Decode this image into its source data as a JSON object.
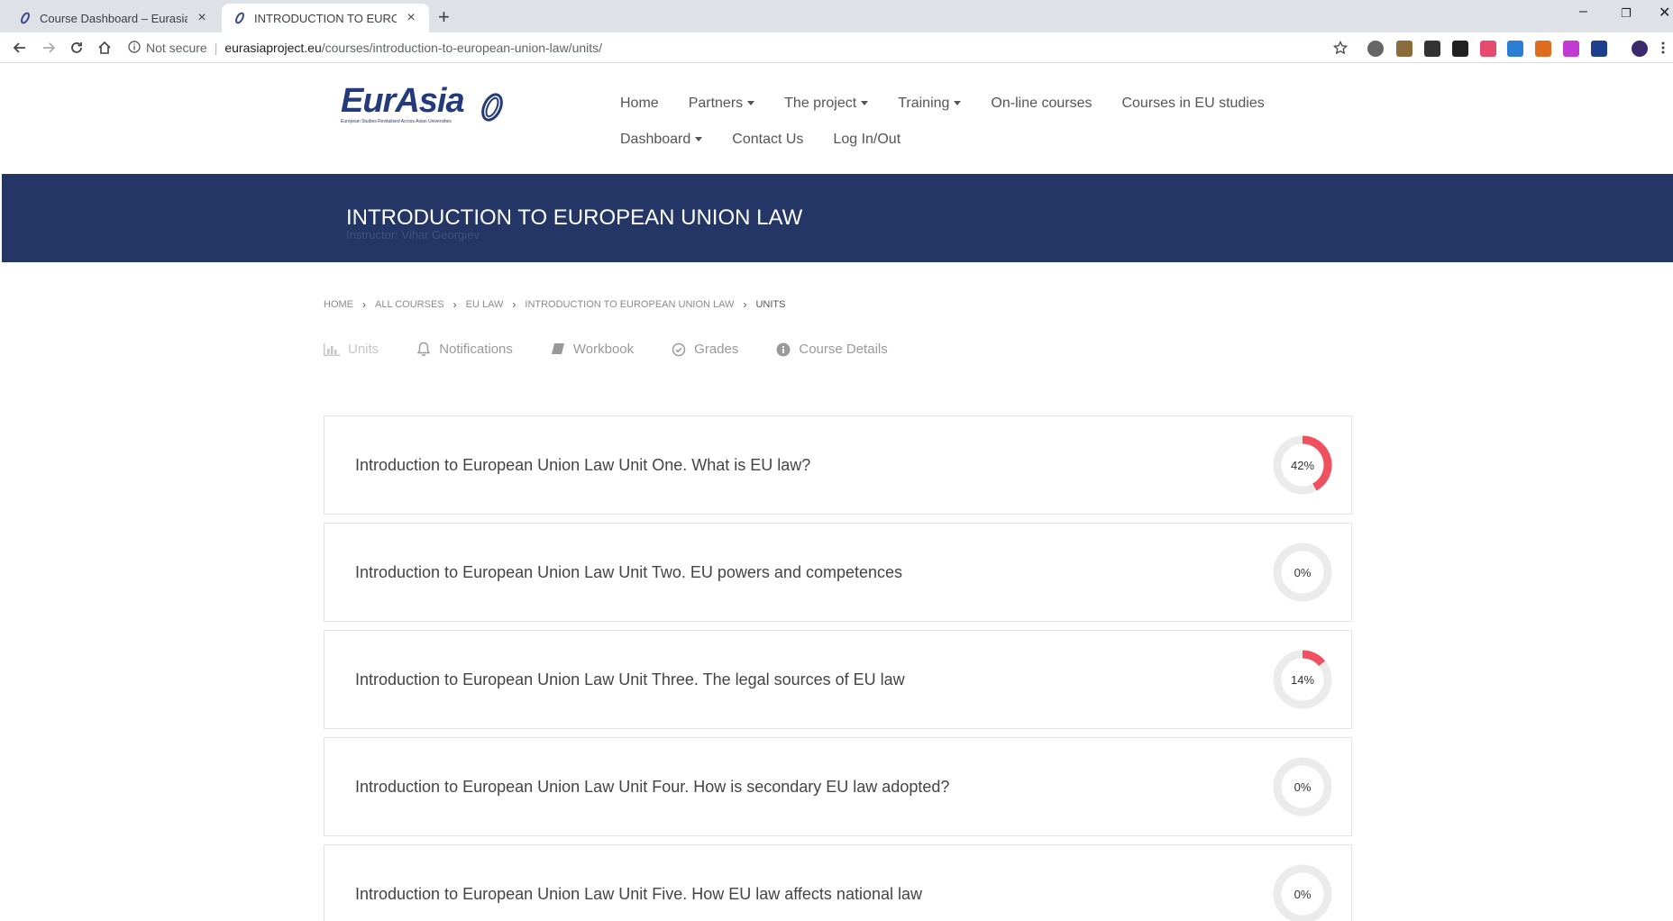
{
  "browser": {
    "tabs": [
      {
        "title": "Course Dashboard – Eurasia",
        "active": false
      },
      {
        "title": "INTRODUCTION TO EUROPEAN UNION LAW",
        "active": true
      }
    ],
    "address": {
      "security": "Not secure",
      "host": "eurasiaproject.eu",
      "path": "/courses/introduction-to-european-union-law/units/"
    }
  },
  "site": {
    "logo_text": "EurAsia",
    "logo_tagline": "European Studies Revitalised Across Asian Universities",
    "nav_row1": [
      {
        "label": "Home",
        "dropdown": false
      },
      {
        "label": "Partners",
        "dropdown": true
      },
      {
        "label": "The project",
        "dropdown": true
      },
      {
        "label": "Training",
        "dropdown": true
      },
      {
        "label": "On-line courses",
        "dropdown": false
      },
      {
        "label": "Courses in EU studies",
        "dropdown": false
      }
    ],
    "nav_row2": [
      {
        "label": "Dashboard",
        "dropdown": true
      },
      {
        "label": "Contact Us",
        "dropdown": false
      },
      {
        "label": "Log In/Out",
        "dropdown": false
      }
    ]
  },
  "hero": {
    "title": "INTRODUCTION TO EUROPEAN UNION LAW",
    "instructor": "Instructor: Vihar Georgiev"
  },
  "breadcrumb": [
    "HOME",
    "ALL COURSES",
    "EU LAW",
    "INTRODUCTION TO EUROPEAN UNION LAW",
    "UNITS"
  ],
  "course_tabs": [
    {
      "label": "Units",
      "icon": "bar-chart-icon",
      "active": true
    },
    {
      "label": "Notifications",
      "icon": "bell-icon",
      "active": false
    },
    {
      "label": "Workbook",
      "icon": "book-icon",
      "active": false
    },
    {
      "label": "Grades",
      "icon": "check-circle-icon",
      "active": false
    },
    {
      "label": "Course Details",
      "icon": "info-icon",
      "active": false
    }
  ],
  "units": [
    {
      "title": "Introduction to European Union Law Unit One. What is EU law?",
      "progress_label": "42%",
      "progress": 42
    },
    {
      "title": "Introduction to European Union Law Unit Two. EU powers and competences",
      "progress_label": "0%",
      "progress": 0
    },
    {
      "title": "Introduction to European Union Law Unit Three. The legal sources of EU law",
      "progress_label": "14%",
      "progress": 14
    },
    {
      "title": "Introduction to European Union Law Unit Four. How is secondary EU law adopted?",
      "progress_label": "0%",
      "progress": 0
    },
    {
      "title": "Introduction to European Union Law Unit Five. How EU law affects national law",
      "progress_label": "0%",
      "progress": 0
    }
  ],
  "colors": {
    "hero_bg": "#233665",
    "progress": "#f0515e",
    "ring_track": "#ebebeb"
  }
}
